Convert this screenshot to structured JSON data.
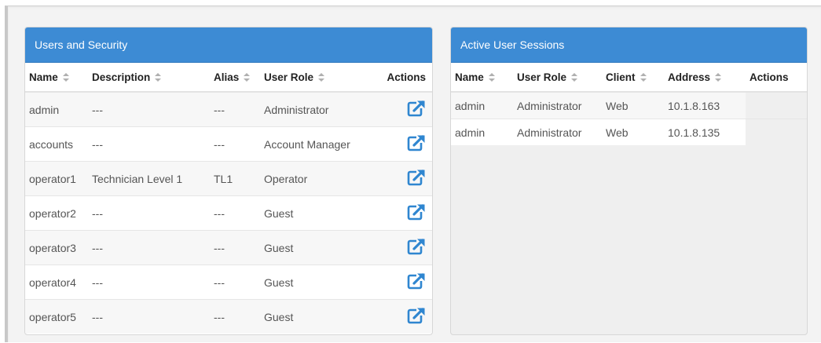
{
  "users_panel": {
    "title": "Users and Security",
    "columns": [
      "Name",
      "Description",
      "Alias",
      "User Role",
      "Actions"
    ],
    "rows": [
      {
        "name": "admin",
        "description": "---",
        "alias": "---",
        "role": "Administrator"
      },
      {
        "name": "accounts",
        "description": "---",
        "alias": "---",
        "role": "Account Manager"
      },
      {
        "name": "operator1",
        "description": "Technician Level 1",
        "alias": "TL1",
        "role": "Operator"
      },
      {
        "name": "operator2",
        "description": "---",
        "alias": "---",
        "role": "Guest"
      },
      {
        "name": "operator3",
        "description": "---",
        "alias": "---",
        "role": "Guest"
      },
      {
        "name": "operator4",
        "description": "---",
        "alias": "---",
        "role": "Guest"
      },
      {
        "name": "operator5",
        "description": "---",
        "alias": "---",
        "role": "Guest"
      }
    ],
    "action_icon": "external-link-icon"
  },
  "sessions_panel": {
    "title": "Active User Sessions",
    "columns": [
      "Name",
      "User Role",
      "Client",
      "Address",
      "Actions"
    ],
    "rows": [
      {
        "name": "admin",
        "role": "Administrator",
        "client": "Web",
        "address": "10.1.8.163"
      },
      {
        "name": "admin",
        "role": "Administrator",
        "client": "Web",
        "address": "10.1.8.135"
      }
    ]
  },
  "colors": {
    "header_blue": "#3d8bd4",
    "icon_blue": "#2f86d0"
  }
}
